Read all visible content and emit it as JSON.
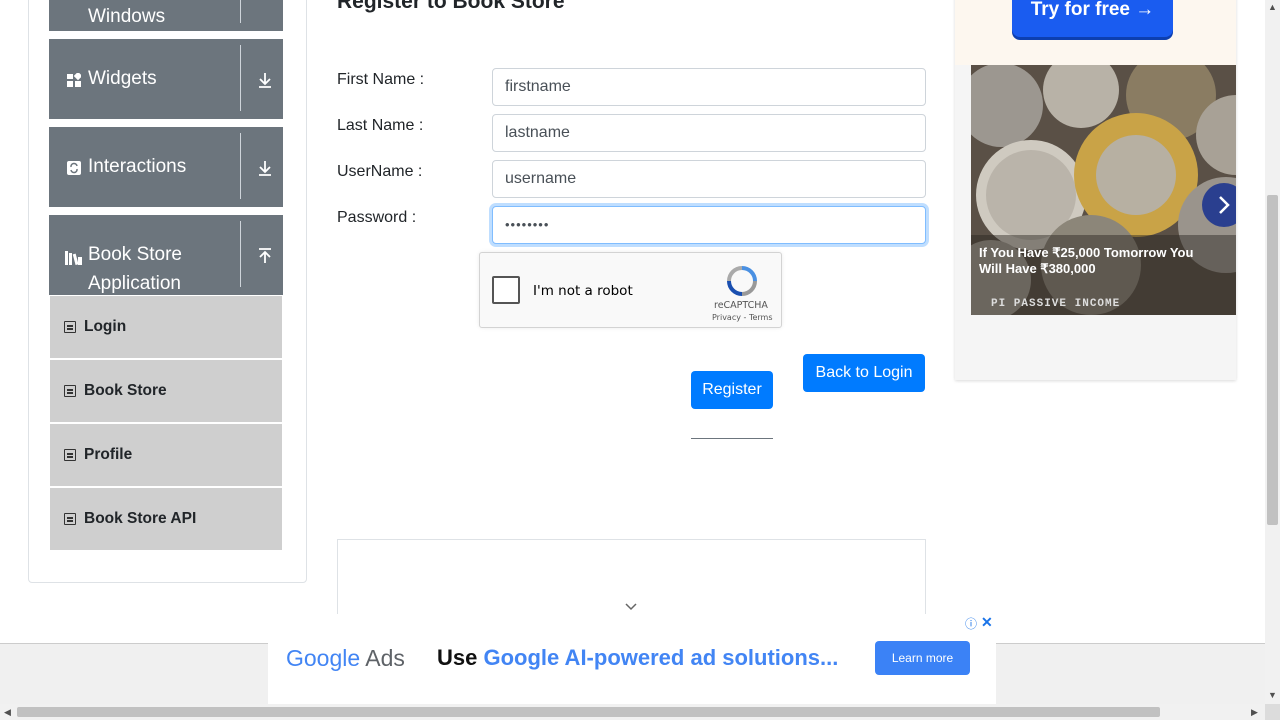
{
  "sidebar": {
    "groups": [
      {
        "label": "Windows",
        "icon": "window-icon",
        "arrow": "down"
      },
      {
        "label": "Widgets",
        "icon": "widgets-icon",
        "arrow": "down"
      },
      {
        "label": "Interactions",
        "icon": "interactions-icon",
        "arrow": "down"
      },
      {
        "label_line1": "Book Store",
        "label_line2": "Application",
        "icon": "books-icon",
        "arrow": "up"
      }
    ],
    "items": [
      {
        "label": "Login"
      },
      {
        "label": "Book Store"
      },
      {
        "label": "Profile"
      },
      {
        "label": "Book Store API"
      }
    ]
  },
  "form": {
    "title": "Register to Book Store",
    "fields": [
      {
        "label": "First Name :",
        "value": "firstname"
      },
      {
        "label": "Last Name :",
        "value": "lastname"
      },
      {
        "label": "UserName :",
        "value": "username"
      },
      {
        "label": "Password :",
        "value": "••••••••"
      }
    ],
    "captcha": {
      "label": "I'm not a robot",
      "brand": "reCAPTCHA",
      "links": "Privacy - Terms"
    },
    "register_label": "Register",
    "back_label": "Back to Login"
  },
  "right_ad": {
    "cta": "Try for free →",
    "caption": "If You Have ₹25,000 Tomorrow You Will Have ₹380,000",
    "brand": "PI PASSIVE INCOME"
  },
  "bottom_ad": {
    "logo_google": "Google",
    "logo_ads": "Ads",
    "headline_plain": "Use ",
    "headline_accent": "Google AI-powered ad solutions...",
    "button": "Learn more",
    "close": "✕"
  },
  "colors": {
    "primary": "#007bff",
    "sidebar_group": "#6c757d",
    "sidebar_item": "#cfcfcf"
  }
}
